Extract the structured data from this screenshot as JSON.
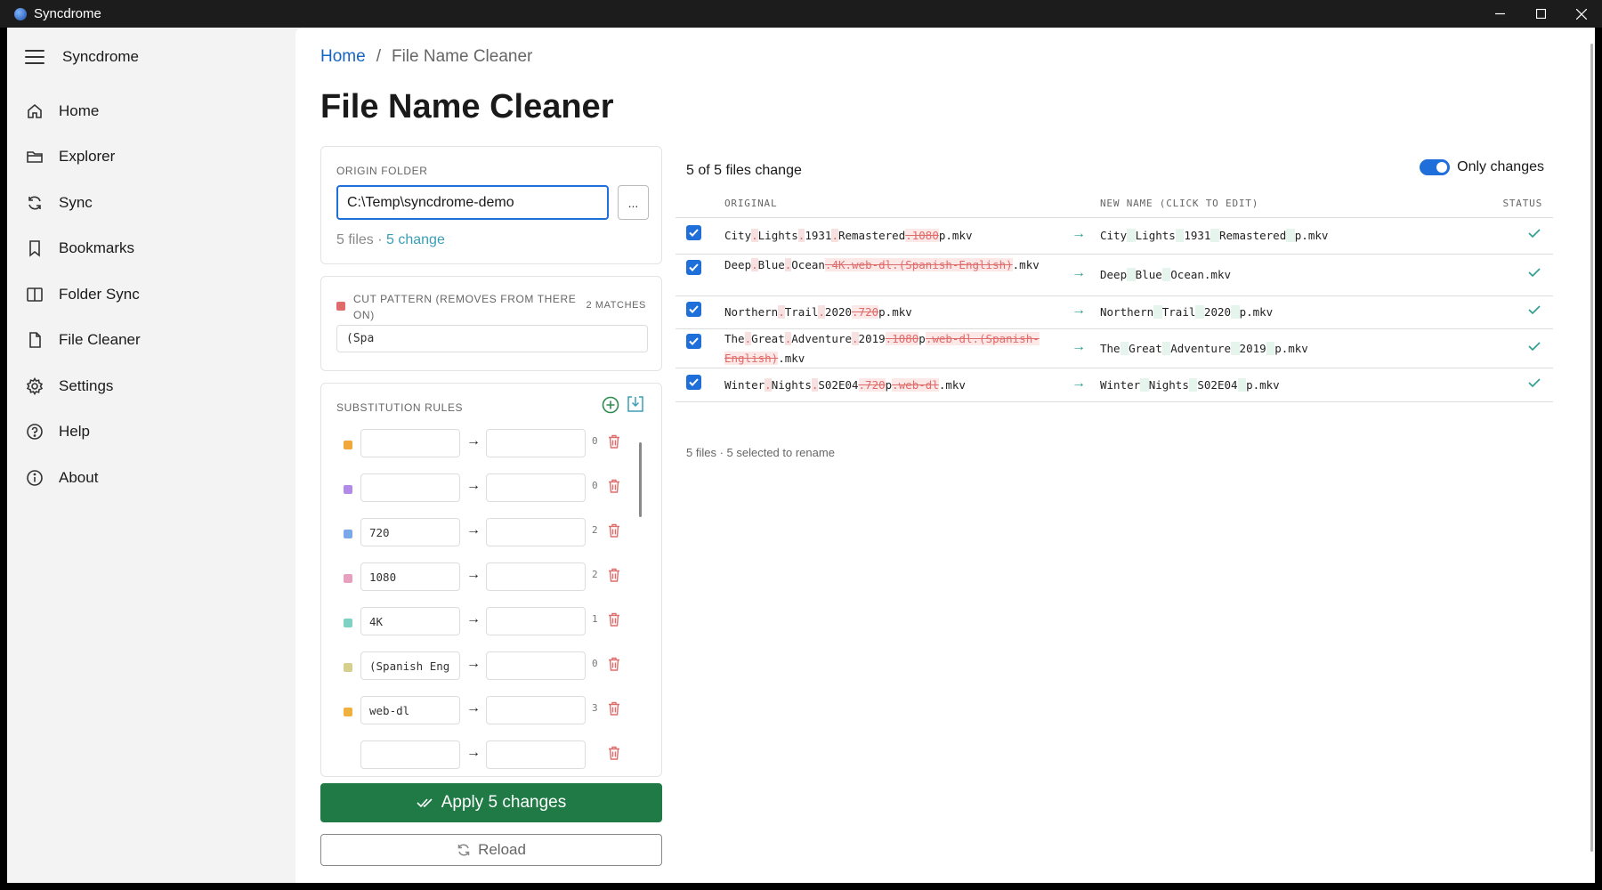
{
  "window": {
    "title": "Syncdrome"
  },
  "sidebar": {
    "app_name": "Syncdrome",
    "items": [
      {
        "label": "Home",
        "icon": "home-icon"
      },
      {
        "label": "Explorer",
        "icon": "folder-icon"
      },
      {
        "label": "Sync",
        "icon": "sync-icon"
      },
      {
        "label": "Bookmarks",
        "icon": "bookmark-icon"
      },
      {
        "label": "Folder Sync",
        "icon": "columns-icon"
      },
      {
        "label": "File Cleaner",
        "icon": "file-icon"
      },
      {
        "label": "Settings",
        "icon": "gear-icon"
      },
      {
        "label": "Help",
        "icon": "help-icon"
      },
      {
        "label": "About",
        "icon": "info-icon"
      }
    ]
  },
  "breadcrumb": {
    "home": "Home",
    "separator": "/",
    "current": "File Name Cleaner"
  },
  "page_title": "File Name Cleaner",
  "origin": {
    "label": "ORIGIN FOLDER",
    "path": "C:\\Temp\\syncdrome-demo",
    "browse_label": "...",
    "files_text": "5 files · ",
    "change_text": "5 change"
  },
  "cut_pattern": {
    "label": "CUT PATTERN (REMOVES FROM THERE ON)",
    "matches": "2 MATCHES",
    "value": "(Spa",
    "color": "#e06b6b"
  },
  "substitution": {
    "label": "SUBSTITUTION RULES",
    "rules": [
      {
        "from": "",
        "to": "",
        "count": "0",
        "color": "#f0a83a"
      },
      {
        "from": "",
        "to": "",
        "count": "0",
        "color": "#b48ae8"
      },
      {
        "from": "720",
        "to": "",
        "count": "2",
        "color": "#7aa8e8"
      },
      {
        "from": "1080",
        "to": "",
        "count": "2",
        "color": "#e8a0c0"
      },
      {
        "from": "4K",
        "to": "",
        "count": "1",
        "color": "#7fd1c4"
      },
      {
        "from": "(Spanish Eng",
        "to": "",
        "count": "0",
        "color": "#d6cf8e"
      },
      {
        "from": "web-dl",
        "to": "",
        "count": "3",
        "color": "#f0b040"
      },
      {
        "from": "",
        "to": "",
        "count": "",
        "color": "#ffffff"
      }
    ]
  },
  "actions": {
    "apply": "Apply 5 changes",
    "reload": "Reload"
  },
  "files": {
    "summary": "5 of 5 files change",
    "only_changes_label": "Only changes",
    "only_changes": true,
    "columns": {
      "original": "ORIGINAL",
      "new_name": "NEW NAME (CLICK TO EDIT)",
      "status": "STATUS"
    },
    "rows": [
      {
        "original": [
          [
            "City",
            ""
          ],
          [
            ".",
            "sep"
          ],
          [
            "Lights",
            ""
          ],
          [
            ".",
            "sep"
          ],
          [
            "1931",
            ""
          ],
          [
            ".",
            "sep"
          ],
          [
            "Remastered",
            ""
          ],
          [
            ".1080",
            "del"
          ],
          [
            "p.mkv",
            ""
          ]
        ],
        "new_name": [
          [
            "City",
            ""
          ],
          [
            ".",
            "nsep"
          ],
          [
            "Lights",
            ""
          ],
          [
            ".",
            "nsep"
          ],
          [
            "1931",
            ""
          ],
          [
            ".",
            "nsep"
          ],
          [
            "Remastered",
            ""
          ],
          [
            ".",
            "nsep"
          ],
          [
            "p.mkv",
            ""
          ]
        ],
        "checked": true,
        "status": "ok"
      },
      {
        "original": [
          [
            "Deep",
            ""
          ],
          [
            ".",
            "sep"
          ],
          [
            "Blue",
            ""
          ],
          [
            ".",
            "sep"
          ],
          [
            "Ocean",
            ""
          ],
          [
            ".4K.web-dl.(Spanish-English)",
            "del"
          ],
          [
            ".mkv",
            ""
          ]
        ],
        "new_name": [
          [
            "Deep",
            ""
          ],
          [
            ".",
            "nsep"
          ],
          [
            "Blue",
            ""
          ],
          [
            ".",
            "nsep"
          ],
          [
            "Ocean.mkv",
            ""
          ]
        ],
        "checked": true,
        "status": "ok"
      },
      {
        "original": [
          [
            "Northern",
            ""
          ],
          [
            ".",
            "sep"
          ],
          [
            "Trail",
            ""
          ],
          [
            ".",
            "sep"
          ],
          [
            "2020",
            ""
          ],
          [
            ".720",
            "del"
          ],
          [
            "p.mkv",
            ""
          ]
        ],
        "new_name": [
          [
            "Northern",
            ""
          ],
          [
            ".",
            "nsep"
          ],
          [
            "Trail",
            ""
          ],
          [
            ".",
            "nsep"
          ],
          [
            "2020",
            ""
          ],
          [
            ".",
            "nsep"
          ],
          [
            "p.mkv",
            ""
          ]
        ],
        "checked": true,
        "status": "ok"
      },
      {
        "original": [
          [
            "The",
            ""
          ],
          [
            ".",
            "sep"
          ],
          [
            "Great",
            ""
          ],
          [
            ".",
            "sep"
          ],
          [
            "Adventure",
            ""
          ],
          [
            ".",
            "sep"
          ],
          [
            "2019",
            ""
          ],
          [
            ".1080",
            "del"
          ],
          [
            "p",
            ""
          ],
          [
            ".web-dl.(Spanish-English)",
            "del"
          ],
          [
            ".mkv",
            ""
          ]
        ],
        "new_name": [
          [
            "The",
            ""
          ],
          [
            ".",
            "nsep"
          ],
          [
            "Great",
            ""
          ],
          [
            ".",
            "nsep"
          ],
          [
            "Adventure",
            ""
          ],
          [
            ".",
            "nsep"
          ],
          [
            "2019",
            ""
          ],
          [
            ".",
            "nsep"
          ],
          [
            "p.mkv",
            ""
          ]
        ],
        "checked": true,
        "status": "ok"
      },
      {
        "original": [
          [
            "Winter",
            ""
          ],
          [
            ".",
            "sep"
          ],
          [
            "Nights",
            ""
          ],
          [
            ".",
            "sep"
          ],
          [
            "S02E04",
            ""
          ],
          [
            ".720",
            "del"
          ],
          [
            "p",
            ""
          ],
          [
            ".web-dl",
            "del"
          ],
          [
            ".mkv",
            ""
          ]
        ],
        "new_name": [
          [
            "Winter",
            ""
          ],
          [
            ".",
            "nsep"
          ],
          [
            "Nights",
            ""
          ],
          [
            ".",
            "nsep"
          ],
          [
            "S02E04",
            ""
          ],
          [
            ".",
            "nsep"
          ],
          [
            "p.mkv",
            ""
          ]
        ],
        "checked": true,
        "status": "ok"
      }
    ],
    "footer": "5 files · 5 selected to rename"
  }
}
